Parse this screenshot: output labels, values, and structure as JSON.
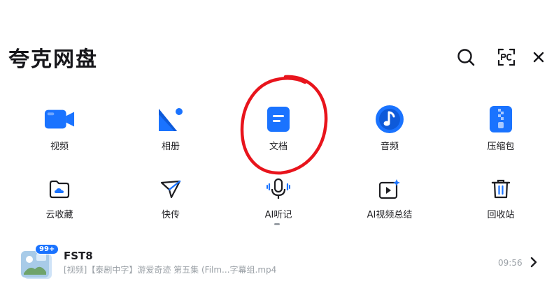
{
  "header": {
    "title": "夸克网盘",
    "icons": {
      "search": "search-icon",
      "pc": "pc-transfer-icon",
      "close": "close-icon"
    }
  },
  "features_row1": [
    {
      "label": "视频",
      "icon": "video-icon"
    },
    {
      "label": "相册",
      "icon": "photo-album-icon"
    },
    {
      "label": "文档",
      "icon": "document-icon"
    },
    {
      "label": "音频",
      "icon": "audio-icon"
    },
    {
      "label": "压缩包",
      "icon": "archive-icon"
    }
  ],
  "features_row2": [
    {
      "label": "云收藏",
      "icon": "cloud-favorite-icon"
    },
    {
      "label": "快传",
      "icon": "quick-transfer-icon"
    },
    {
      "label": "AI听记",
      "icon": "ai-voice-note-icon"
    },
    {
      "label": "AI视频总结",
      "icon": "ai-video-summary-icon"
    },
    {
      "label": "回收站",
      "icon": "recycle-bin-icon"
    }
  ],
  "recent": {
    "badge": "99+",
    "name": "FST8",
    "path": "[视频]【泰剧中字】游爱奇迹 第五集 (Film...字幕组.mp4",
    "time": "09:56"
  },
  "colors": {
    "accent": "#1a73ff",
    "annotation": "#e8141c",
    "muted": "#9aa0a6"
  }
}
